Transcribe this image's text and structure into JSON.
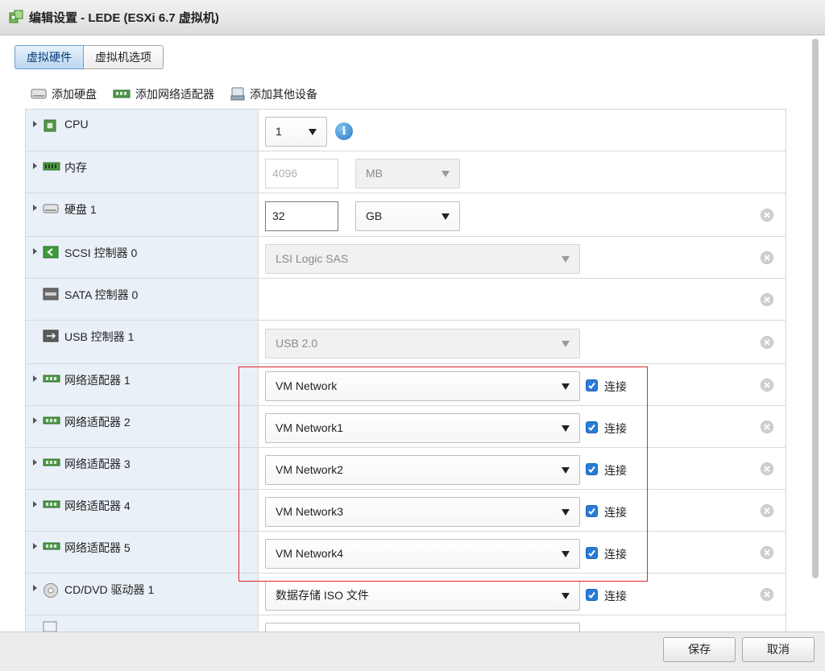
{
  "window": {
    "title": "编辑设置 - LEDE (ESXi 6.7 虚拟机)"
  },
  "tabs": [
    {
      "label": "虚拟硬件",
      "active": true
    },
    {
      "label": "虚拟机选项",
      "active": false
    }
  ],
  "toolbar": {
    "add_disk": "添加硬盘",
    "add_network": "添加网络适配器",
    "add_other": "添加其他设备"
  },
  "rows": {
    "cpu": {
      "label": "CPU",
      "value": "1"
    },
    "memory": {
      "label": "内存",
      "value": "4096",
      "unit": "MB"
    },
    "disk": {
      "label": "硬盘 1",
      "value": "32",
      "unit": "GB"
    },
    "scsi": {
      "label": "SCSI 控制器 0",
      "value": "LSI Logic SAS"
    },
    "sata": {
      "label": "SATA 控制器 0"
    },
    "usb": {
      "label": "USB 控制器 1",
      "value": "USB 2.0"
    },
    "net1": {
      "label": "网络适配器 1",
      "value": "VM Network",
      "connect": "连接",
      "checked": true
    },
    "net2": {
      "label": "网络适配器 2",
      "value": "VM Network1",
      "connect": "连接",
      "checked": true
    },
    "net3": {
      "label": "网络适配器 3",
      "value": "VM Network2",
      "connect": "连接",
      "checked": true
    },
    "net4": {
      "label": "网络适配器 4",
      "value": "VM Network3",
      "connect": "连接",
      "checked": true
    },
    "net5": {
      "label": "网络适配器 5",
      "value": "VM Network4",
      "connect": "连接",
      "checked": true
    },
    "cdrom": {
      "label": "CD/DVD 驱动器 1",
      "value": "数据存储 ISO 文件",
      "connect": "连接",
      "checked": true
    }
  },
  "footer": {
    "save": "保存",
    "cancel": "取消"
  },
  "colors": {
    "accent": "#2b7bd6",
    "highlight_box": "#e0242c",
    "label_column": "#e9f0f7"
  }
}
